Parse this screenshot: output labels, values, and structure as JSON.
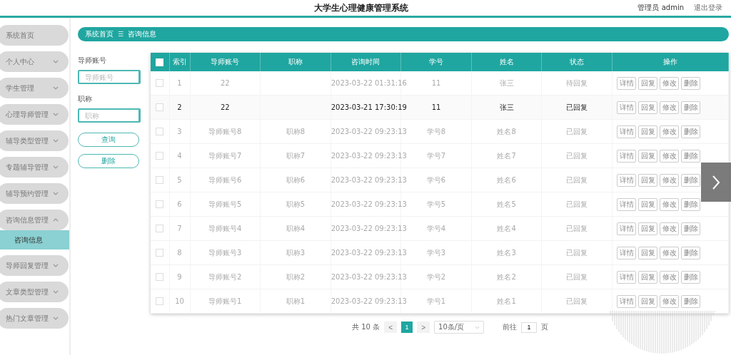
{
  "header": {
    "title": "大学生心理健康管理系统",
    "user": "管理员 admin",
    "logout": "退出登录"
  },
  "sidebar": {
    "items": [
      {
        "label": "系统首页"
      },
      {
        "label": "个人中心",
        "expanded": false
      },
      {
        "label": "学生管理",
        "expanded": false
      },
      {
        "label": "心理导师管理",
        "expanded": false
      },
      {
        "label": "辅导类型管理",
        "expanded": false
      },
      {
        "label": "专题辅导管理",
        "expanded": false
      },
      {
        "label": "辅导预约管理",
        "expanded": false
      },
      {
        "label": "咨询信息管理",
        "expanded": true,
        "children": [
          {
            "label": "咨询信息",
            "selected": true
          }
        ]
      },
      {
        "label": "导师回复管理",
        "expanded": false
      },
      {
        "label": "文章类型管理",
        "expanded": false
      },
      {
        "label": "热门文章管理",
        "expanded": false
      }
    ]
  },
  "breadcrumb": {
    "home": "系统首页",
    "separator": "☰",
    "current": "咨询信息"
  },
  "filters": [
    {
      "label": "导师账号",
      "placeholder": "导师账号"
    },
    {
      "label": "职称",
      "placeholder": "职称"
    }
  ],
  "filter_buttons": [
    "查询",
    "删除"
  ],
  "table": {
    "all_checked": false,
    "columns": [
      "索引",
      "导师账号",
      "职称",
      "咨询时间",
      "学号",
      "姓名",
      "状态",
      "操作"
    ],
    "rows": [
      {
        "index": "1",
        "account": "22",
        "title": "",
        "time": "2023-03-22 01:31:16",
        "student_no": "11",
        "name": "张三",
        "status": "待回复",
        "highlighted": false,
        "checked": false,
        "actions": [
          "详情",
          "回复",
          "修改",
          "删除"
        ]
      },
      {
        "index": "2",
        "account": "22",
        "title": "",
        "time": "2023-03-21 17:30:19",
        "student_no": "11",
        "name": "张三",
        "status": "已回复",
        "highlighted": true,
        "checked": false,
        "actions": [
          "详情",
          "回复",
          "修改",
          "删除"
        ]
      },
      {
        "index": "3",
        "account": "导师账号8",
        "title": "职称8",
        "time": "2023-03-22 09:23:13",
        "student_no": "学号8",
        "name": "姓名8",
        "status": "已回复",
        "highlighted": false,
        "checked": false,
        "actions": [
          "详情",
          "回复",
          "修改",
          "删除"
        ]
      },
      {
        "index": "4",
        "account": "导师账号7",
        "title": "职称7",
        "time": "2023-03-22 09:23:13",
        "student_no": "学号7",
        "name": "姓名7",
        "status": "已回复",
        "highlighted": false,
        "checked": false,
        "actions": [
          "详情",
          "回复",
          "修改",
          "删除"
        ]
      },
      {
        "index": "5",
        "account": "导师账号6",
        "title": "职称6",
        "time": "2023-03-22 09:23:13",
        "student_no": "学号6",
        "name": "姓名6",
        "status": "已回复",
        "highlighted": false,
        "checked": false,
        "actions": [
          "详情",
          "回复",
          "修改",
          "删除"
        ]
      },
      {
        "index": "6",
        "account": "导师账号5",
        "title": "职称5",
        "time": "2023-03-22 09:23:13",
        "student_no": "学号5",
        "name": "姓名5",
        "status": "已回复",
        "highlighted": false,
        "checked": false,
        "actions": [
          "详情",
          "回复",
          "修改",
          "删除"
        ]
      },
      {
        "index": "7",
        "account": "导师账号4",
        "title": "职称4",
        "time": "2023-03-22 09:23:13",
        "student_no": "学号4",
        "name": "姓名4",
        "status": "已回复",
        "highlighted": false,
        "checked": false,
        "actions": [
          "详情",
          "回复",
          "修改",
          "删除"
        ]
      },
      {
        "index": "8",
        "account": "导师账号3",
        "title": "职称3",
        "time": "2023-03-22 09:23:13",
        "student_no": "学号3",
        "name": "姓名3",
        "status": "已回复",
        "highlighted": false,
        "checked": false,
        "actions": [
          "详情",
          "回复",
          "修改",
          "删除"
        ]
      },
      {
        "index": "9",
        "account": "导师账号2",
        "title": "职称2",
        "time": "2023-03-22 09:23:13",
        "student_no": "学号2",
        "name": "姓名2",
        "status": "已回复",
        "highlighted": false,
        "checked": false,
        "actions": [
          "详情",
          "回复",
          "修改",
          "删除"
        ]
      },
      {
        "index": "10",
        "account": "导师账号1",
        "title": "职称1",
        "time": "2023-03-22 09:23:13",
        "student_no": "学号1",
        "name": "姓名1",
        "status": "已回复",
        "highlighted": false,
        "checked": false,
        "actions": [
          "详情",
          "回复",
          "修改",
          "删除"
        ]
      }
    ]
  },
  "pagination": {
    "total": "共 10 条",
    "prev": "<",
    "pages": [
      {
        "label": "1",
        "selected": true
      }
    ],
    "next": ">",
    "page_size": "10条/页",
    "goto_label": "前往",
    "goto_value": "1",
    "goto_suffix": "页"
  }
}
